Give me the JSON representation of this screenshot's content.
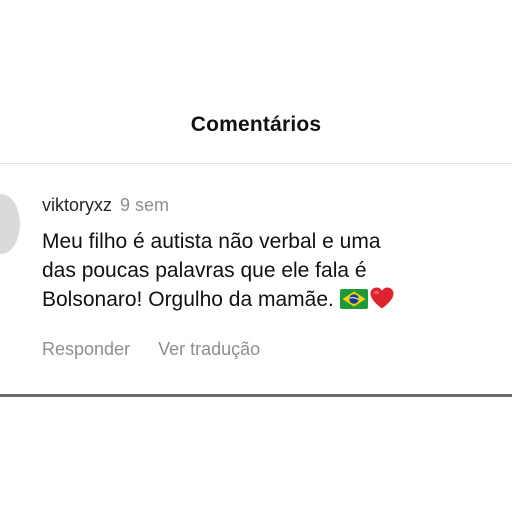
{
  "header": {
    "title": "Comentários"
  },
  "comment": {
    "username": "viktoryxz",
    "timestamp": "9 sem",
    "text_lines": [
      "Meu filho é autista não verbal e uma",
      "das poucas palavras que ele fala é",
      "Bolsonaro! Orgulho da mamãe."
    ],
    "emojis": [
      "brazil-flag-icon",
      "red-heart-icon"
    ]
  },
  "actions": {
    "reply_label": "Responder",
    "translate_label": "Ver tradução"
  },
  "colors": {
    "text_primary": "#111111",
    "text_secondary": "#8e8e8e",
    "divider": "#e3e3e3",
    "avatar": "#dadada",
    "flag_green": "#1f9a3a",
    "flag_yellow": "#f4d40b",
    "flag_blue": "#1b3a8c",
    "heart_red": "#e0212e"
  }
}
